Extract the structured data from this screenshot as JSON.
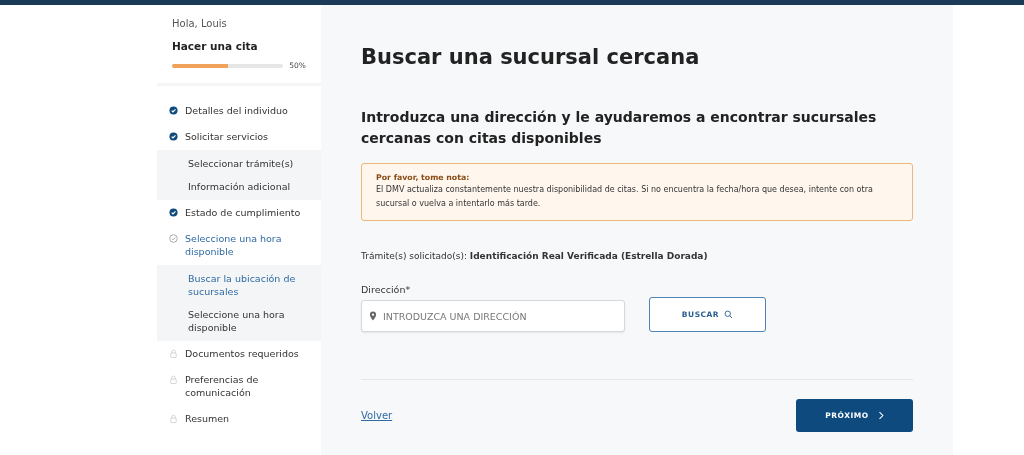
{
  "sidebar": {
    "greeting": "Hola, Louis",
    "title": "Hacer una cita",
    "progress": {
      "level": 0.5,
      "reading": "50%"
    },
    "steps": [
      {
        "label": "Detalles del individuo",
        "kind": "done"
      },
      {
        "label": "Solicitar servicios",
        "kind": "done",
        "children": [
          {
            "label": "Seleccionar trámite(s)",
            "selected": false
          },
          {
            "label": "Información adicional",
            "selected": false
          }
        ]
      },
      {
        "label": "Estado de cumplimiento",
        "kind": "done"
      },
      {
        "label": "Seleccione una hora disponible",
        "kind": "current",
        "children": [
          {
            "label": "Buscar la ubicación de sucursales",
            "selected": true
          },
          {
            "label": "Seleccione una hora disponible",
            "selected": false
          }
        ]
      },
      {
        "label": "Documentos requeridos",
        "kind": "locked"
      },
      {
        "label": "Preferencias de comunicación",
        "kind": "locked"
      },
      {
        "label": "Resumen",
        "kind": "locked"
      }
    ]
  },
  "main": {
    "title": "Buscar una sucursal cercana",
    "subtitle": "Introduzca una dirección y le ayudaremos a encontrar sucursales cercanas con citas disponibles",
    "notice": {
      "title": "Por favor, tome nota:",
      "text": "El DMV actualiza constantemente nuestra disponibilidad de citas. Si no encuentra la fecha/hora que desea, intente con otra sucursal o vuelva a intentarlo más tarde."
    },
    "requested": {
      "label": "Trámite(s) solicitado(s):",
      "value": "Identificación Real Verificada (Estrella Dorada)"
    },
    "address": {
      "label": "Dirección*",
      "placeholder": "INTRODUZCA UNA DIRECCIÓN"
    },
    "search_button": "BUSCAR",
    "back_link": "Volver",
    "next_button": "PRÓXIMO"
  }
}
